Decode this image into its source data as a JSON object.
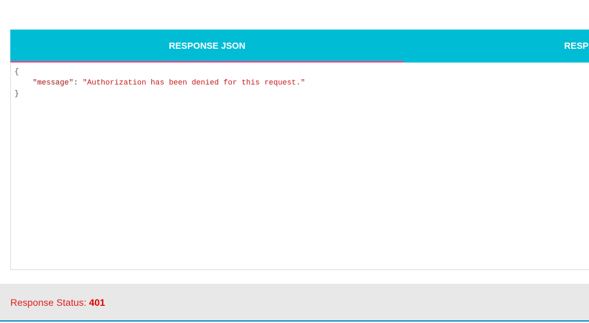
{
  "tabs": [
    {
      "label": "RESPONSE JSON",
      "active": true
    },
    {
      "label": "RESPONSE RAW",
      "active": false
    }
  ],
  "json_view": {
    "open_brace": "{",
    "key": "\"message\"",
    "separator": ": ",
    "value": "\"Authorization has been denied for this request.\"",
    "close_brace": "}"
  },
  "status": {
    "label": "Response Status: ",
    "code": "401"
  },
  "colors": {
    "tab_bar": "#00bcd4",
    "tab_indicator": "#ff4081",
    "status_text": "#e02020",
    "status_bar_bg": "#e8e8e8"
  }
}
